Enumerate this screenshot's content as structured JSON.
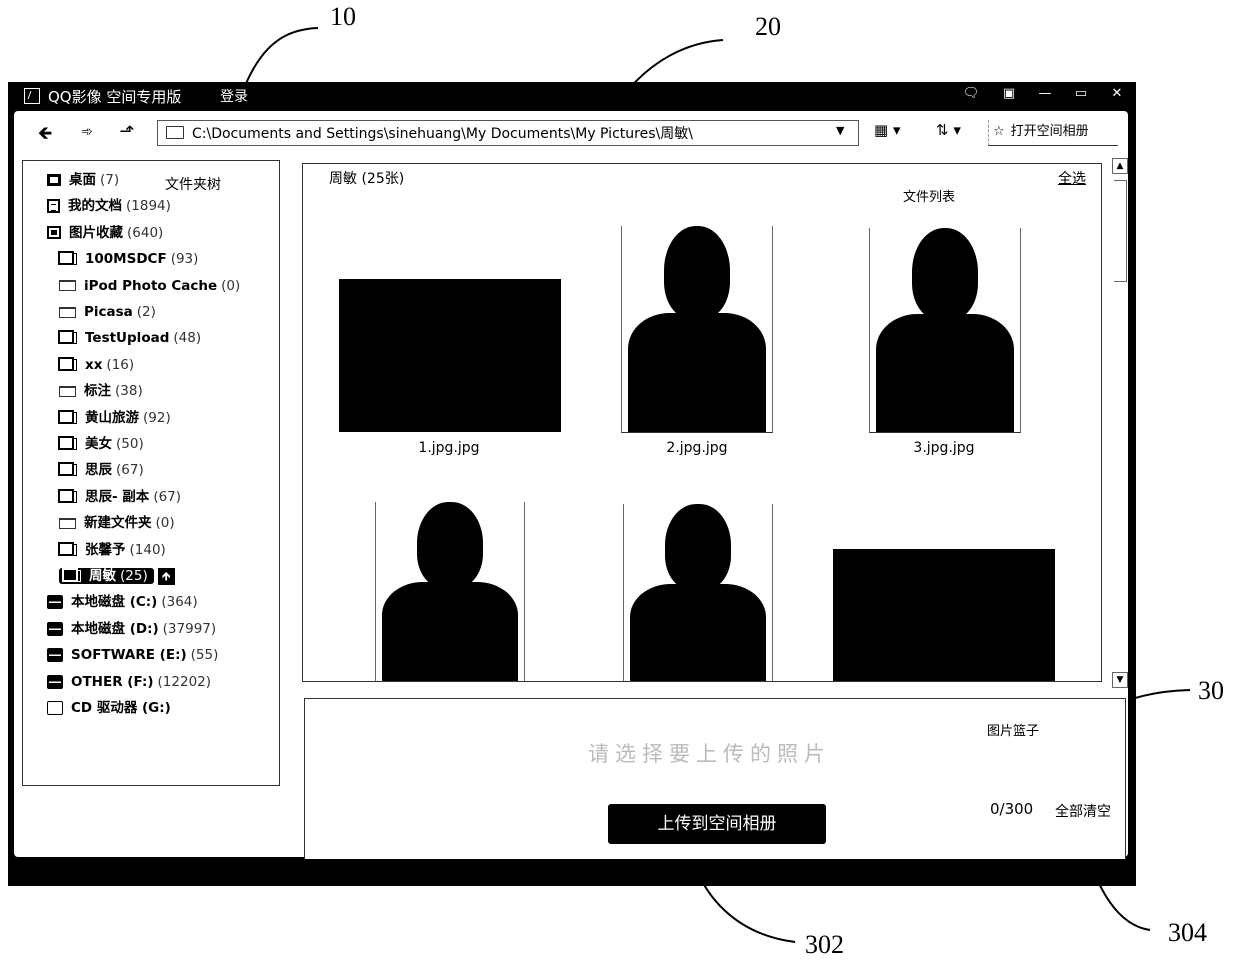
{
  "window": {
    "title": "QQ影像 空间专用版",
    "login_label": "登录",
    "controls": [
      {
        "name": "feedback",
        "glyph": "🗨"
      },
      {
        "name": "skin",
        "glyph": "▣"
      },
      {
        "name": "minimize",
        "glyph": "—"
      },
      {
        "name": "maximize",
        "glyph": "▭"
      },
      {
        "name": "close",
        "glyph": "✕"
      }
    ]
  },
  "toolbar": {
    "back_glyph": "🡸",
    "forward_glyph": "➾",
    "up_glyph": "⬏",
    "address": "C:\\Documents and Settings\\sinehuang\\My Documents\\My Pictures\\周敏\\",
    "address_dropdown_glyph": "▼",
    "view_glyph": "▦ ▾",
    "sort_glyph": "⇅ ▾",
    "open_album_icon": "☆",
    "open_album_label": "打开空间相册"
  },
  "tree": {
    "annotation": "文件夹树",
    "items": [
      {
        "label": "桌面",
        "count": "(7)",
        "icon": "desktop-icon",
        "level": 0
      },
      {
        "label": "我的文档",
        "count": "(1894)",
        "icon": "documents-icon",
        "level": 0
      },
      {
        "label": "图片收藏",
        "count": "(640)",
        "icon": "pictures-icon",
        "level": 0
      },
      {
        "label": "100MSDCF",
        "count": "(93)",
        "icon": "photo-folder-icon",
        "level": 1
      },
      {
        "label": "iPod Photo Cache",
        "count": "(0)",
        "icon": "folder-icon",
        "level": 1
      },
      {
        "label": "Picasa",
        "count": "(2)",
        "icon": "folder-icon",
        "level": 1
      },
      {
        "label": "TestUpload",
        "count": "(48)",
        "icon": "photo-folder-icon",
        "level": 1
      },
      {
        "label": "xx",
        "count": "(16)",
        "icon": "photo-folder-icon",
        "level": 1
      },
      {
        "label": "标注",
        "count": "(38)",
        "icon": "folder-icon",
        "level": 1
      },
      {
        "label": "黄山旅游",
        "count": "(92)",
        "icon": "photo-folder-icon",
        "level": 1
      },
      {
        "label": "美女",
        "count": "(50)",
        "icon": "photo-folder-icon",
        "level": 1
      },
      {
        "label": "思辰",
        "count": "(67)",
        "icon": "photo-folder-icon",
        "level": 1
      },
      {
        "label": "思辰- 副本",
        "count": "(67)",
        "icon": "photo-folder-icon",
        "level": 1
      },
      {
        "label": "新建文件夹",
        "count": "(0)",
        "icon": "folder-icon",
        "level": 1
      },
      {
        "label": "张馨予",
        "count": "(140)",
        "icon": "photo-folder-icon",
        "level": 1
      },
      {
        "label": "周敏",
        "count": "(25)",
        "icon": "photo-folder-icon",
        "level": 1,
        "selected": true
      },
      {
        "label": "本地磁盘 (C:)",
        "count": "(364)",
        "icon": "drive-icon",
        "level": 0
      },
      {
        "label": "本地磁盘 (D:)",
        "count": "(37997)",
        "icon": "drive-icon",
        "level": 0
      },
      {
        "label": "SOFTWARE (E:)",
        "count": "(55)",
        "icon": "drive-icon",
        "level": 0
      },
      {
        "label": "OTHER (F:)",
        "count": "(12202)",
        "icon": "drive-icon",
        "level": 0
      },
      {
        "label": "CD 驱动器 (G:)",
        "count": "",
        "icon": "cd-drive-icon",
        "level": 0
      }
    ],
    "upload_glyph": "🡹"
  },
  "filelist": {
    "title": "周敏 (25张)",
    "annotation": "文件列表",
    "select_all": "全选",
    "photos": [
      {
        "name": "1.jpg.jpg"
      },
      {
        "name": "2.jpg.jpg"
      },
      {
        "name": "3.jpg.jpg"
      },
      {
        "name": ""
      },
      {
        "name": ""
      },
      {
        "name": ""
      }
    ]
  },
  "basket": {
    "annotation": "图片篮子",
    "hint": "请选择要上传的照片",
    "upload_label": "上传到空间相册",
    "counter": "0/300",
    "clear_all": "全部清空"
  },
  "callouts": {
    "c10": "10",
    "c20": "20",
    "c30": "30",
    "c302": "302",
    "c304": "304"
  }
}
